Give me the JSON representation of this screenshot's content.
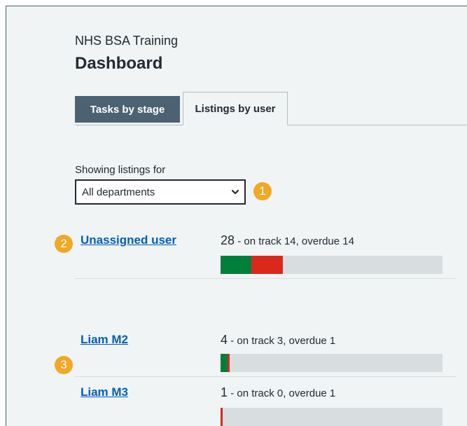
{
  "header": {
    "org": "NHS BSA Training",
    "title": "Dashboard"
  },
  "tabs": [
    {
      "label": "Tasks by stage",
      "active": false
    },
    {
      "label": "Listings by user",
      "active": true
    }
  ],
  "filter": {
    "label": "Showing listings for",
    "value": "All departments"
  },
  "badges": [
    "1",
    "2",
    "3"
  ],
  "users": [
    {
      "name": "Unassigned user",
      "total": "28",
      "detail": " - on track 14, overdue 14",
      "on_track": 14,
      "overdue": 14,
      "scale_max": 100
    },
    {
      "name": "Liam M2",
      "total": "4",
      "detail": " - on track 3, overdue 1",
      "on_track": 3,
      "overdue": 1,
      "scale_max": 100
    },
    {
      "name": "Liam M3",
      "total": "1",
      "detail": " - on track 0, overdue 1",
      "on_track": 0,
      "overdue": 1,
      "scale_max": 100
    }
  ],
  "colors": {
    "on_track": "#007f3b",
    "overdue": "#da291c",
    "bar_bg": "#d8dde0",
    "link": "#005eb8",
    "badge": "#f0a825"
  }
}
